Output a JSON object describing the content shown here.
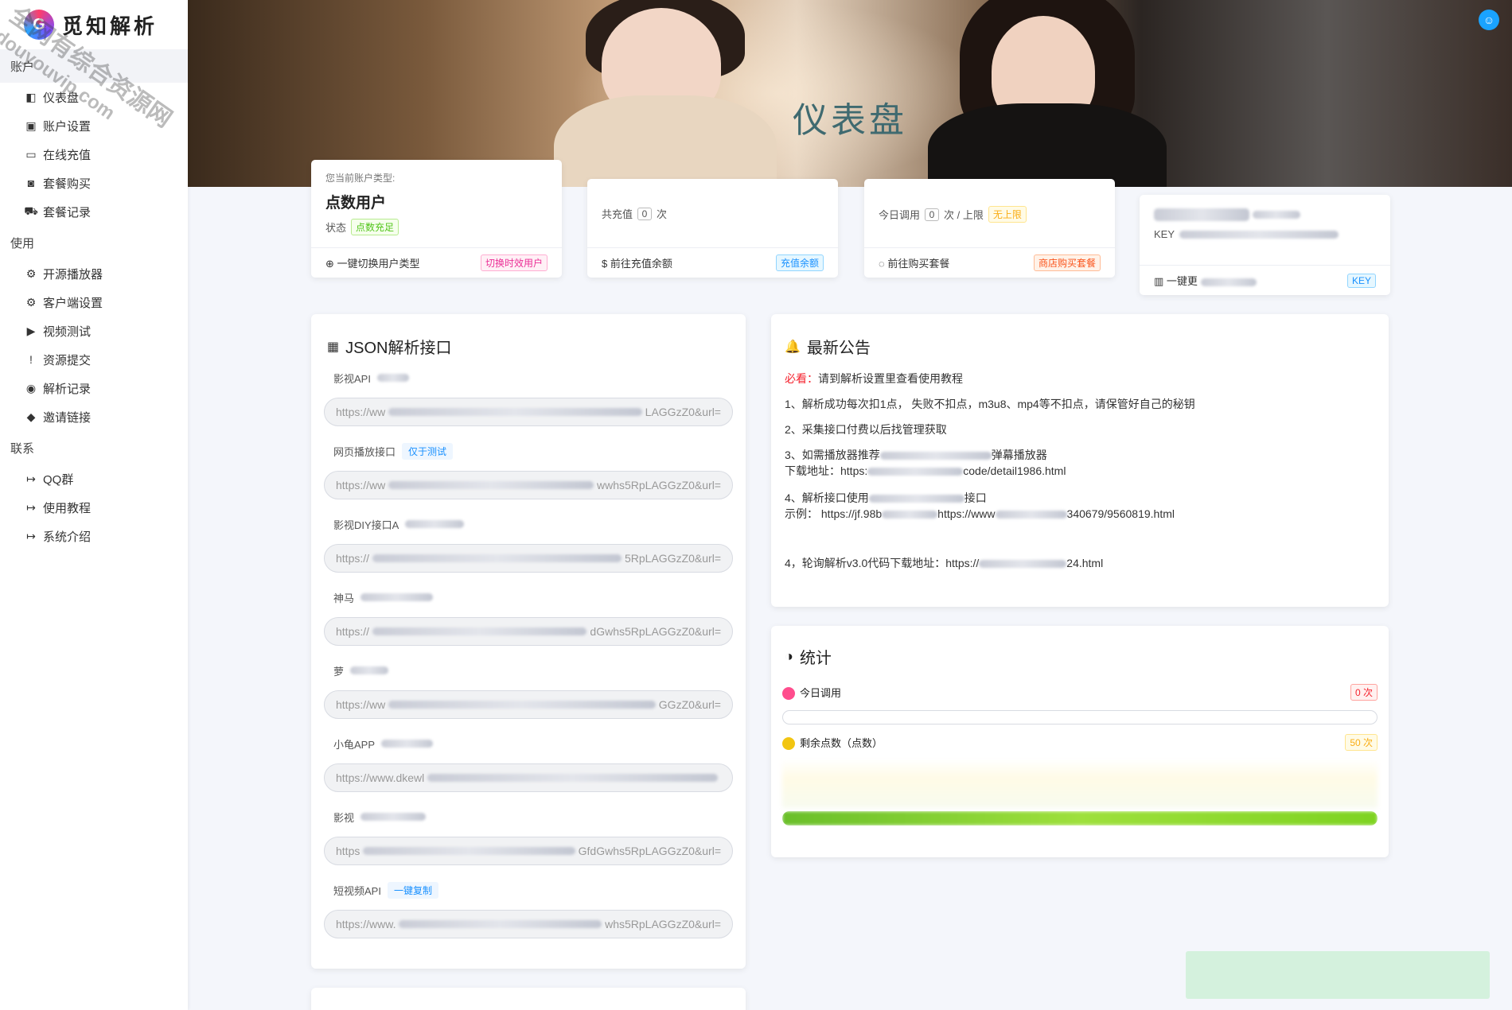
{
  "brand": {
    "name": "觅知解析"
  },
  "watermark": {
    "line1": "全网有综合资源网",
    "line2": "douyouvip.com"
  },
  "sidebar": {
    "sections": [
      {
        "title": "账户",
        "items": [
          {
            "label": "仪表盘",
            "icon": "dashboard-icon",
            "glyph": "◧"
          },
          {
            "label": "账户设置",
            "icon": "user-card-icon",
            "glyph": "▣"
          },
          {
            "label": "在线充值",
            "icon": "credit-card-icon",
            "glyph": "▭"
          },
          {
            "label": "套餐购买",
            "icon": "briefcase-icon",
            "glyph": "◙"
          },
          {
            "label": "套餐记录",
            "icon": "cart-icon",
            "glyph": "⛟"
          }
        ]
      },
      {
        "title": "使用",
        "items": [
          {
            "label": "开源播放器",
            "icon": "gear-icon",
            "glyph": "⚙"
          },
          {
            "label": "客户端设置",
            "icon": "gear-icon",
            "glyph": "⚙"
          },
          {
            "label": "视频测试",
            "icon": "play-icon",
            "glyph": "▶"
          },
          {
            "label": "资源提交",
            "icon": "alert-icon",
            "glyph": "!"
          },
          {
            "label": "解析记录",
            "icon": "eye-icon",
            "glyph": "◉"
          },
          {
            "label": "邀请链接",
            "icon": "tag-icon",
            "glyph": "◆"
          }
        ]
      },
      {
        "title": "联系",
        "items": [
          {
            "label": "QQ群",
            "icon": "sign-in-icon",
            "glyph": "↦"
          },
          {
            "label": "使用教程",
            "icon": "sign-in-icon",
            "glyph": "↦"
          },
          {
            "label": "系统介绍",
            "icon": "sign-in-icon",
            "glyph": "↦"
          }
        ]
      }
    ]
  },
  "hero": {
    "title": "仪表盘"
  },
  "cards": {
    "account": {
      "label": "您当前账户类型:",
      "type": "点数用户",
      "status_label": "状态",
      "status": "点数充足",
      "action": "一键切换用户类型",
      "action_tag": "切换时效用户"
    },
    "recharge": {
      "total_label": "共充值",
      "total_value": "0",
      "unit": "次",
      "action": "前往充值余额",
      "action_tag": "充值余额"
    },
    "usage": {
      "today_label": "今日调用",
      "today_value": "0",
      "unit": "次 / 上限",
      "limit": "无上限",
      "action": "前往购买套餐",
      "action_tag": "商店购买套餐"
    },
    "key": {
      "key_label": "KEY",
      "action": "一键更",
      "action_tag": "KEY"
    }
  },
  "json_api": {
    "title": "JSON解析接口",
    "items": [
      {
        "label": "影视API",
        "tag": "",
        "url": "https://ww",
        "url_tail": "LAGGzZ0&url="
      },
      {
        "label": "网页播放接口",
        "tag": "仅于测试",
        "url": "https://ww",
        "url_tail": "wwhs5RpLAGGzZ0&url="
      },
      {
        "label": "影视DIY接口A",
        "tag": "",
        "url": "https://",
        "url_tail": "5RpLAGGzZ0&url="
      },
      {
        "label": "神马",
        "tag": "",
        "url": "https://",
        "url_tail": "dGwhs5RpLAGGzZ0&url="
      },
      {
        "label": "萝",
        "tag": "",
        "url": "https://ww",
        "url_tail": "GGzZ0&url="
      },
      {
        "label": "小龟APP",
        "tag": "",
        "url": "https://www.dkewl",
        "url_tail": ""
      },
      {
        "label": "影视",
        "tag": "",
        "url": "https",
        "url_tail": "GfdGwhs5RpLAGGzZ0&url="
      },
      {
        "label": "短视频API",
        "tag": "一键复制",
        "url": "https://www.",
        "url_tail": "whs5RpLAGGzZ0&url="
      }
    ]
  },
  "notice": {
    "title": "最新公告",
    "must_label": "必看：",
    "must_text": "请到解析设置里查看使用教程",
    "line1": "1、解析成功每次扣1点， 失败不扣点，m3u8、mp4等不扣点，请保管好自己的秘钥",
    "line2": "2、采集接口付费以后找管理获取",
    "line3a": "3、如需播放器推荐",
    "line3b": "弹幕播放器",
    "line3c": "下载地址：https:",
    "line3d": "code/detail1986.html",
    "line4a": "4、解析接口使用",
    "line4b": "接口",
    "line4c": "示例：  https://jf.98b",
    "line4d": "https://www",
    "line4e": "340679/9560819.html",
    "line5a": "4，轮询解析v3.0代码下载地址：https://",
    "line5b": "24.html"
  },
  "stats": {
    "title": "统计",
    "today_label": "今日调用",
    "today_value": "0 次",
    "today_progress": 0,
    "remain_label": "剩余点数（点数）",
    "remain_value": "50 次",
    "remain_progress": 1.0,
    "colors": {
      "today": "#ff4d8d",
      "remain": "#f2c511"
    }
  }
}
